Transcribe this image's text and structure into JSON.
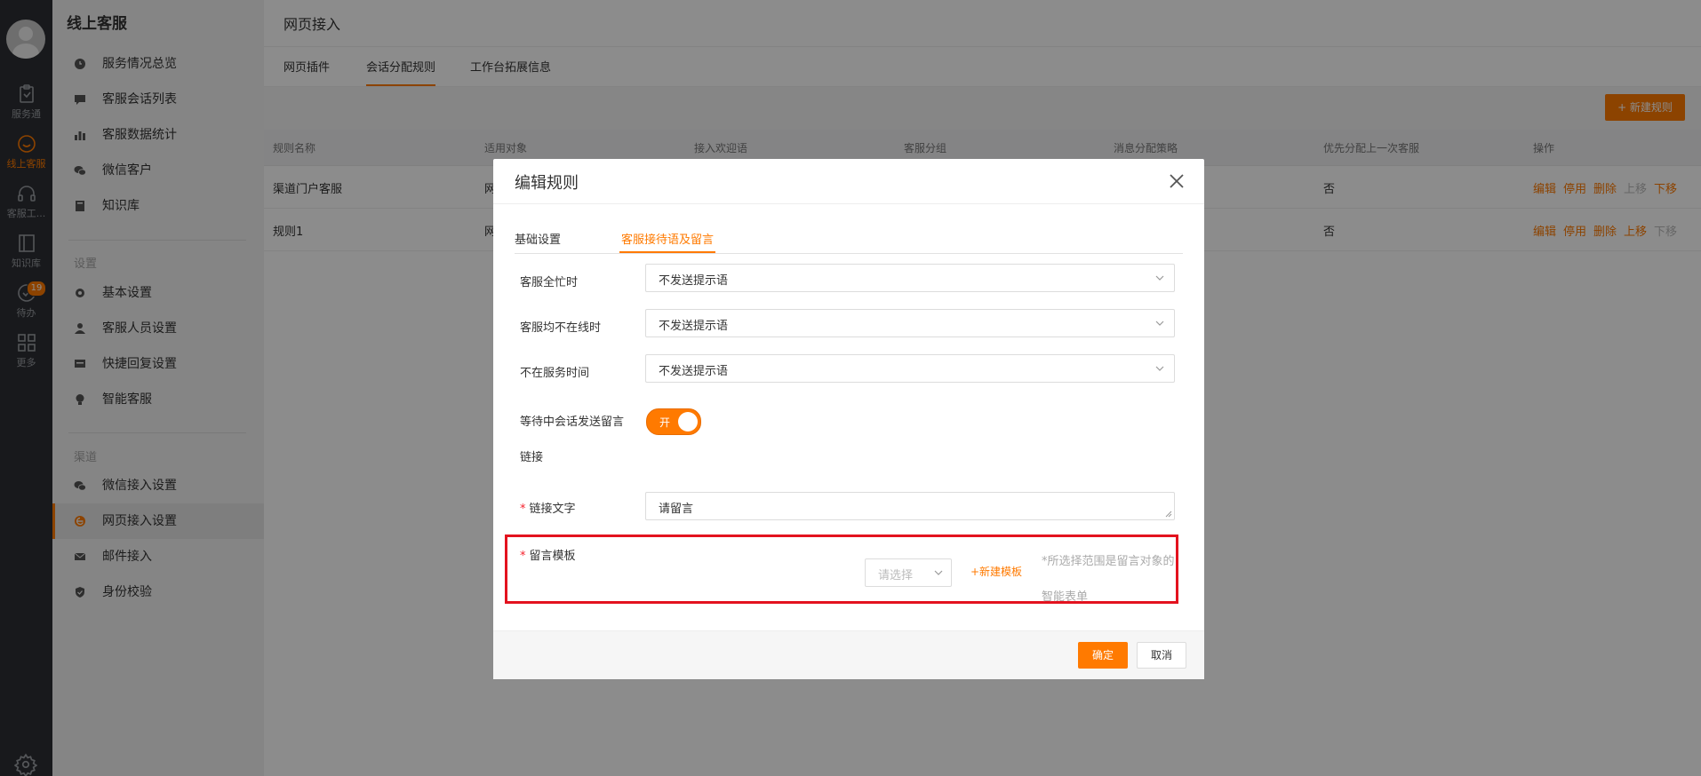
{
  "rail": {
    "items": [
      {
        "label": "服务通",
        "icon": "clipboard-heart-icon"
      },
      {
        "label": "线上客服",
        "icon": "chat-smile-icon",
        "active": true
      },
      {
        "label": "客服工...",
        "icon": "headset-icon"
      },
      {
        "label": "知识库",
        "icon": "book-icon"
      },
      {
        "label": "待办",
        "icon": "check-circle-icon",
        "badge": "19"
      },
      {
        "label": "更多",
        "icon": "grid-icon"
      }
    ]
  },
  "sidebar": {
    "title": "线上客服",
    "items": [
      {
        "label": "服务情况总览"
      },
      {
        "label": "客服会话列表"
      },
      {
        "label": "客服数据统计"
      },
      {
        "label": "微信客户"
      },
      {
        "label": "知识库"
      }
    ],
    "settings_title": "设置",
    "settings_items": [
      {
        "label": "基本设置"
      },
      {
        "label": "客服人员设置"
      },
      {
        "label": "快捷回复设置"
      },
      {
        "label": "智能客服"
      }
    ],
    "channels_title": "渠道",
    "channel_items": [
      {
        "label": "微信接入设置"
      },
      {
        "label": "网页接入设置"
      },
      {
        "label": "邮件接入"
      },
      {
        "label": "身份校验"
      }
    ]
  },
  "main": {
    "title": "网页接入",
    "tabs": [
      {
        "label": "网页插件"
      },
      {
        "label": "会话分配规则"
      },
      {
        "label": "工作台拓展信息"
      }
    ],
    "new_rule_label": "+ 新建规则",
    "table": {
      "headers": [
        "规则名称",
        "适用对象",
        "接入欢迎语",
        "客服分组",
        "消息分配策略",
        "优先分配上一次客服",
        "操作"
      ],
      "rows": [
        {
          "name": "渠道门户客服",
          "target": "网",
          "prev": "否"
        },
        {
          "name": "规则1",
          "target": "网",
          "prev": "否"
        }
      ],
      "ops": [
        "编辑",
        "停用",
        "删除",
        "上移",
        "下移"
      ]
    }
  },
  "modal": {
    "title": "编辑规则",
    "tabs": [
      {
        "label": "基础设置"
      },
      {
        "label": "客服接待语及留言"
      }
    ],
    "fields": {
      "all_busy_label": "客服全忙时",
      "all_busy_value": "不发送提示语",
      "all_offline_label": "客服均不在线时",
      "all_offline_value": "不发送提示语",
      "off_hours_label": "不在服务时间",
      "off_hours_value": "不发送提示语",
      "waiting_msg_label": "等待中会话发送留言",
      "waiting_msg_label2": "链接",
      "toggle_text": "开",
      "link_text_label": "链接文字",
      "link_text_value": "请留言",
      "template_label": "留言模板",
      "template_placeholder": "请选择",
      "new_template_label": "+新建模板",
      "template_hint": "*所选择范围是留言对象的智能表单"
    },
    "ok_label": "确定",
    "cancel_label": "取消"
  },
  "colors": {
    "accent": "#ff7a00",
    "rail_bg": "#2d2f33",
    "highlight_box": "#e3121e"
  }
}
